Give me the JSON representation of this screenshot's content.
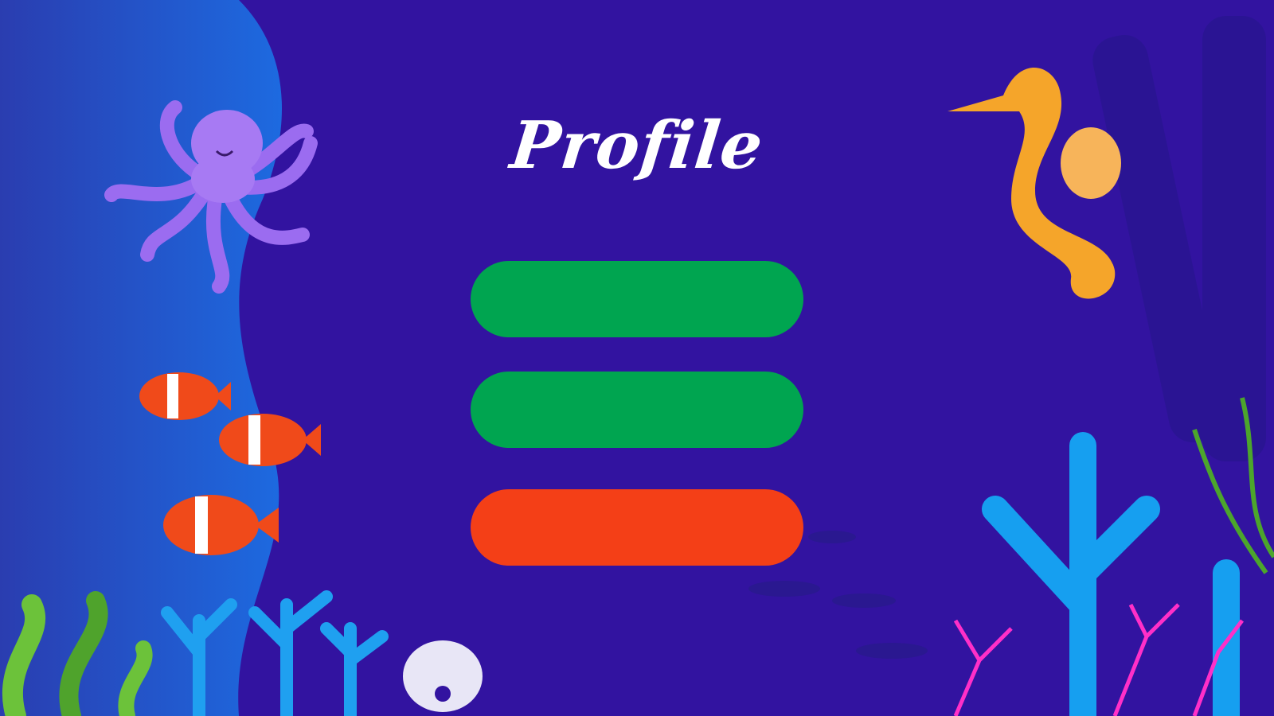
{
  "page": {
    "title": "Profile"
  },
  "buttons": [
    {
      "label": "",
      "color": "#00a550"
    },
    {
      "label": "",
      "color": "#00a550"
    },
    {
      "label": "",
      "color": "#f43f17"
    }
  ],
  "colors": {
    "background": "#3213a0",
    "left_panel": "#1e5ad8"
  },
  "decorations": [
    "octopus-icon",
    "clownfish-icon",
    "seahorse-icon",
    "seaweed-icon",
    "coral-icon",
    "seashell-icon",
    "fish-shadow-icon"
  ]
}
